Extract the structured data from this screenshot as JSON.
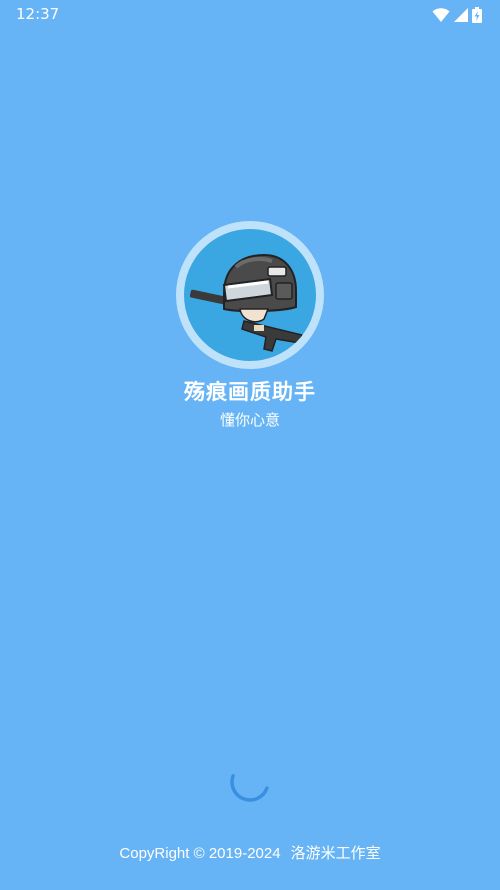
{
  "status_bar": {
    "time": "12:37",
    "icons": [
      "wifi-icon",
      "cellular-signal-icon",
      "battery-charging-icon"
    ]
  },
  "app": {
    "name": "殇痕画质助手",
    "slogan": "懂你心意",
    "logo": "helmet-soldier-logo"
  },
  "loading": {
    "indicator": "spinner-icon"
  },
  "footer": {
    "copyright": "CopyRight © 2019-2024",
    "studio": "洛游米工作室"
  },
  "colors": {
    "background": "#66b4f5",
    "logo_ring": "#bfe2fb",
    "logo_fill": "#3aa6e2",
    "spinner": "#3b8fe0",
    "text": "#ffffff"
  }
}
